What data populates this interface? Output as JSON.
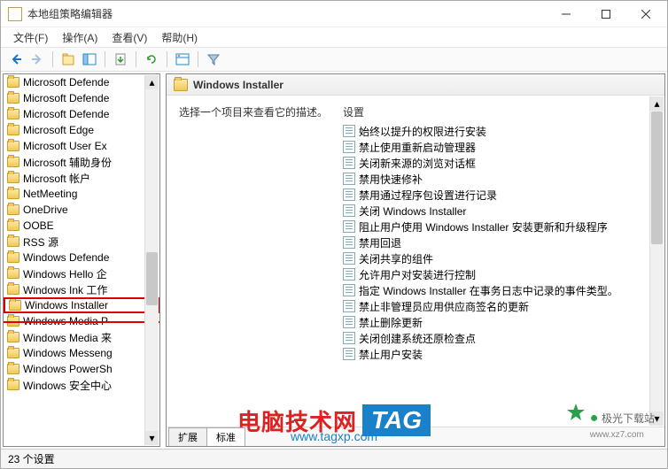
{
  "window": {
    "title": "本地组策略编辑器"
  },
  "menu": {
    "file": "文件(F)",
    "action": "操作(A)",
    "view": "查看(V)",
    "help": "帮助(H)"
  },
  "tree": {
    "items": [
      "Microsoft Defende",
      "Microsoft Defende",
      "Microsoft Defende",
      "Microsoft Edge",
      "Microsoft User Ex",
      "Microsoft 辅助身份",
      "Microsoft 帐户",
      "NetMeeting",
      "OneDrive",
      "OOBE",
      "RSS 源",
      "Windows Defende",
      "Windows Hello 企",
      "Windows Ink 工作",
      "Windows Installer",
      "Windows Media P",
      "Windows Media 来",
      "Windows Messeng",
      "Windows PowerSh",
      "Windows 安全中心"
    ],
    "selected_index": 14,
    "strike_index": 15
  },
  "detail": {
    "header": "Windows Installer",
    "description": "选择一个项目来查看它的描述。",
    "column_header": "设置",
    "settings": [
      "始终以提升的权限进行安装",
      "禁止使用重新启动管理器",
      "关闭新来源的浏览对话框",
      "禁用快速修补",
      "禁用通过程序包设置进行记录",
      "关闭 Windows Installer",
      "阻止用户使用 Windows Installer 安装更新和升级程序",
      "禁用回退",
      "关闭共享的组件",
      "允许用户对安装进行控制",
      "指定 Windows Installer 在事务日志中记录的事件类型。",
      "禁止非管理员应用供应商签名的更新",
      "禁止删除更新",
      "关闭创建系统还原检查点",
      "禁止用户安装"
    ]
  },
  "tabs": {
    "extended": "扩展",
    "standard": "标准"
  },
  "status": "23 个设置",
  "watermark": {
    "text": "电脑技术网",
    "url": "www.tagxp.com",
    "tag": "TAG",
    "right": "极光下载站",
    "right_url": "www.xz7.com"
  }
}
